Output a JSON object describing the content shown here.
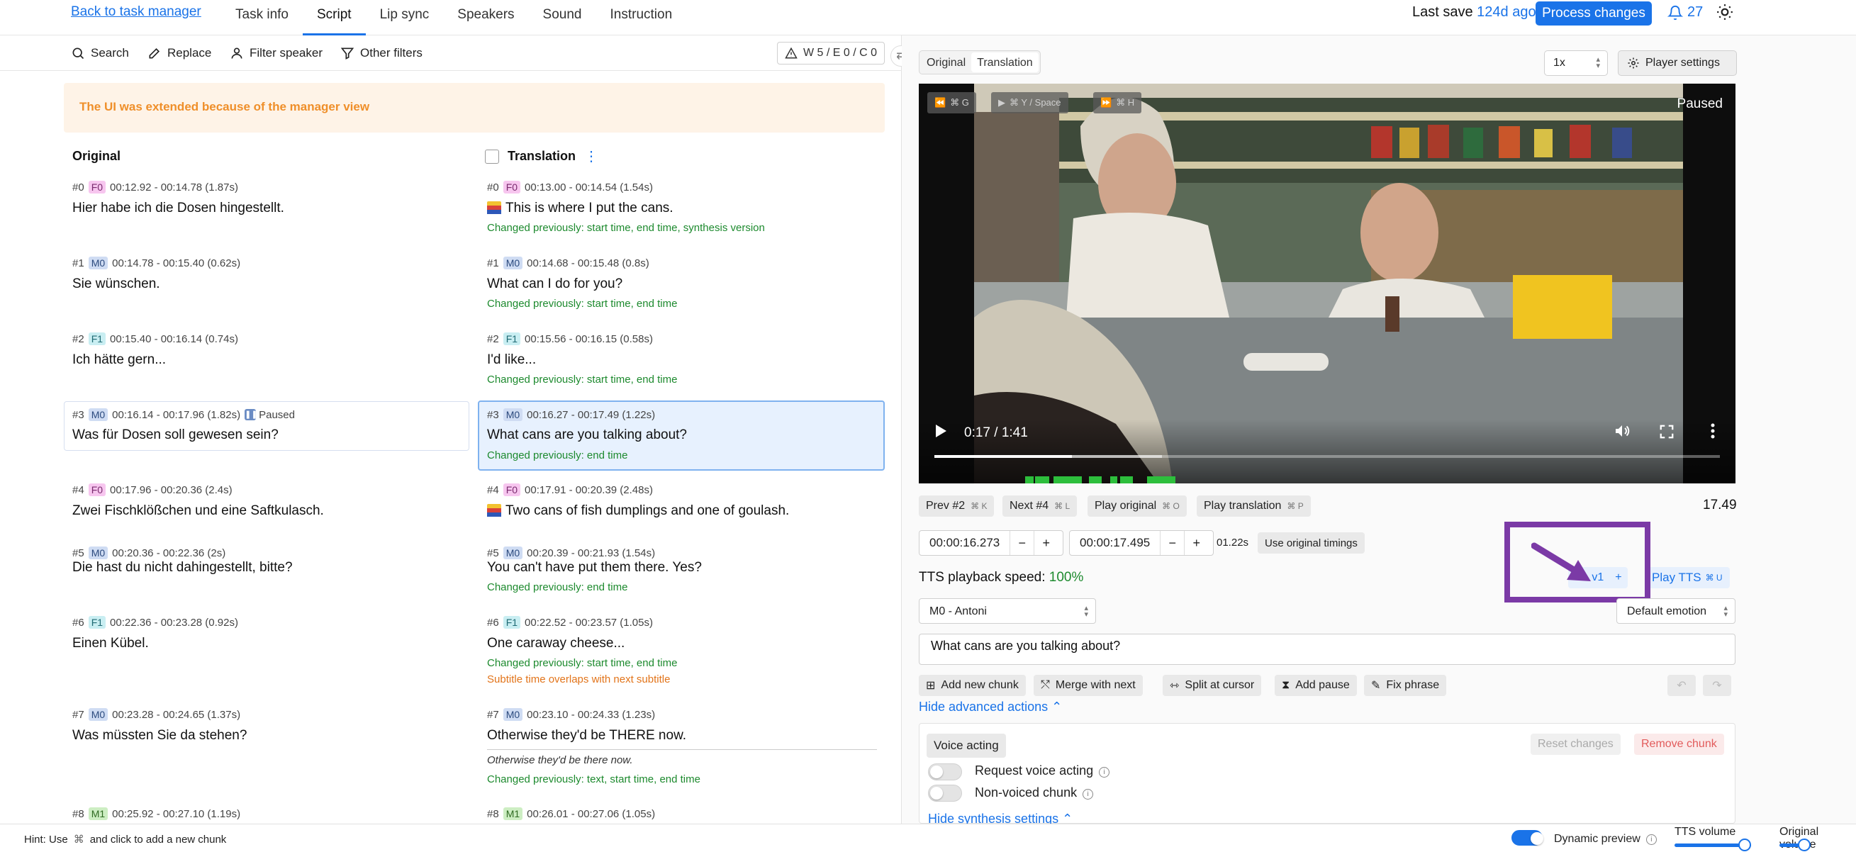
{
  "nav": {
    "back_link": "Back to task manager",
    "tabs": [
      {
        "label": "Task info",
        "active": false
      },
      {
        "label": "Script",
        "active": true
      },
      {
        "label": "Lip sync",
        "active": false
      },
      {
        "label": "Speakers",
        "active": false
      },
      {
        "label": "Sound",
        "active": false
      },
      {
        "label": "Instruction",
        "active": false
      }
    ],
    "last_save_label": "Last save",
    "last_save_ago": "124d ago",
    "process_button": "Process changes",
    "notifications_count": "27",
    "accent_color": "#1a73e8"
  },
  "toolbar": {
    "search": "Search",
    "replace": "Replace",
    "filter_speaker": "Filter speaker",
    "other_filters": "Other filters",
    "warnings": "W 5 / E 0 / C 0"
  },
  "banner": "The UI was extended because of the manager view",
  "columns": {
    "original": "Original",
    "translation": "Translation"
  },
  "segments": [
    {
      "orig_meta": "#0",
      "orig_spk": "F0",
      "orig_time": "00:12.92 - 00:14.78 (1.87s)",
      "orig_text": "Hier habe ich die Dosen hingestellt.",
      "tr_meta": "#0",
      "tr_spk": "F0",
      "tr_time": "00:13.00 - 00:14.54 (1.54s)",
      "tr_text": "This is where I put the cans.",
      "changes": [
        "Changed previously: start time, end time, synthesis version"
      ]
    },
    {
      "orig_meta": "#1",
      "orig_spk": "M0",
      "orig_time": "00:14.78 - 00:15.40 (0.62s)",
      "orig_text": "Sie wünschen.",
      "tr_meta": "#1",
      "tr_spk": "M0",
      "tr_time": "00:14.68 - 00:15.48 (0.8s)",
      "tr_text": "What can I do for you?",
      "changes": [
        "Changed previously: start time, end time"
      ]
    },
    {
      "orig_meta": "#2",
      "orig_spk": "F1",
      "orig_time": "00:15.40 - 00:16.14 (0.74s)",
      "orig_text": "Ich hätte gern...",
      "tr_meta": "#2",
      "tr_spk": "F1",
      "tr_time": "00:15.56 - 00:16.15 (0.58s)",
      "tr_text": "I'd like...",
      "changes": [
        "Changed previously: start time, end time"
      ]
    },
    {
      "orig_meta": "#3",
      "orig_spk": "M0",
      "orig_time": "00:16.14 - 00:17.96 (1.82s)",
      "orig_paused": "Paused",
      "orig_text": "Was für Dosen soll gewesen sein?",
      "tr_meta": "#3",
      "tr_spk": "M0",
      "tr_time": "00:16.27 - 00:17.49 (1.22s)",
      "tr_text": "What cans are you talking about?",
      "changes": [
        "Changed previously: end time"
      ]
    },
    {
      "orig_meta": "#4",
      "orig_spk": "F0",
      "orig_time": "00:17.96 - 00:20.36 (2.4s)",
      "orig_text": "Zwei Fischklößchen und eine Saftkulasch.",
      "tr_meta": "#4",
      "tr_spk": "F0",
      "tr_time": "00:17.91 - 00:20.39 (2.48s)",
      "tr_text": "Two cans of fish dumplings and one of goulash.",
      "changes": []
    },
    {
      "orig_meta": "#5",
      "orig_spk": "M0",
      "orig_time": "00:20.36 - 00:22.36 (2s)",
      "orig_text": "Die hast du nicht dahingestellt, bitte?",
      "tr_meta": "#5",
      "tr_spk": "M0",
      "tr_time": "00:20.39 - 00:21.93 (1.54s)",
      "tr_text": "You can't have put them there. Yes?",
      "changes": [
        "Changed previously: end time"
      ]
    },
    {
      "orig_meta": "#6",
      "orig_spk": "F1",
      "orig_time": "00:22.36 - 00:23.28 (0.92s)",
      "orig_text": "Einen Kübel.",
      "tr_meta": "#6",
      "tr_spk": "F1",
      "tr_time": "00:22.52 - 00:23.57 (1.05s)",
      "tr_text": "One caraway cheese...",
      "changes": [
        "Changed previously: start time, end time"
      ],
      "warning": "Subtitle time overlaps with next subtitle"
    },
    {
      "orig_meta": "#7",
      "orig_spk": "M0",
      "orig_time": "00:23.28 - 00:24.65 (1.37s)",
      "orig_text": "Was müssten Sie da stehen?",
      "tr_meta": "#7",
      "tr_spk": "M0",
      "tr_time": "00:23.10 - 00:24.33 (1.23s)",
      "tr_text": "Otherwise they'd be THERE now.",
      "note": "Otherwise they'd be there now.",
      "changes": [
        "Changed previously: text, start time, end time"
      ]
    },
    {
      "orig_meta": "#8",
      "orig_spk": "M1",
      "orig_time": "00:25.92 - 00:27.10 (1.19s)",
      "orig_text": "",
      "tr_meta": "#8",
      "tr_spk": "M1",
      "tr_time": "00:26.01 - 00:27.06 (1.05s)",
      "tr_text": "",
      "changes": []
    }
  ],
  "player": {
    "tabs": [
      "Original",
      "Translation"
    ],
    "active_tab": "Translation",
    "speed": "1x",
    "settings_button": "Player settings",
    "paused_label": "Paused",
    "rewind_shortcut": "⌘ G",
    "play_shortcut": "⌘ Y / Space",
    "forward_shortcut": "⌘ H",
    "time": "0:17 / 1:41",
    "progress": 0.175
  },
  "chunk": {
    "prev": "Prev #2",
    "prev_sc": "⌘ K",
    "next": "Next #4",
    "next_sc": "⌘ L",
    "play_original": "Play original",
    "play_original_sc": "⌘ O",
    "play_translation": "Play translation",
    "play_translation_sc": "⌘ P",
    "current_time": "17.49",
    "start": "00:00:16.273",
    "end": "00:00:17.495",
    "duration": "01.22s",
    "use_original": "Use original timings",
    "tts_speed_label": "TTS playback speed:",
    "tts_speed_value": "100%",
    "version": "v1",
    "play_tts": "Play TTS",
    "play_tts_sc": "⌘ U",
    "voice": "M0 - Antoni",
    "emotion": "Default emotion",
    "text": "What cans are you talking about?",
    "actions": [
      "Add new chunk",
      "Merge with next",
      "Split at cursor",
      "Add pause",
      "Fix phrase"
    ],
    "hide_advanced": "Hide advanced actions",
    "voice_acting": "Voice acting",
    "reset_changes": "Reset changes",
    "remove_chunk": "Remove chunk",
    "request_voice_acting": "Request voice acting",
    "non_voiced": "Non-voiced chunk",
    "hide_synthesis": "Hide synthesis settings"
  },
  "status": {
    "hint_prefix": "Hint: Use",
    "hint_suffix": "and click to add a new chunk",
    "dynamic_preview": "Dynamic preview",
    "tts_volume": "TTS volume",
    "original_volume": "Original volume"
  }
}
